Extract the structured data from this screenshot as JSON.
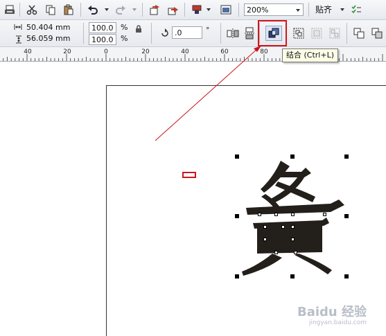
{
  "toolbar_top": {
    "zoom": {
      "value": "200%"
    },
    "snap": {
      "label": "贴齐"
    }
  },
  "toolbar_props": {
    "width": "50.404 mm",
    "height": "56.059 mm",
    "scale_x": "100.0",
    "scale_y": "100.0",
    "percent": "%",
    "rotation": ".0",
    "degree": "°"
  },
  "ruler": {
    "labels": [
      "40",
      "20",
      "0",
      "20",
      "40",
      "60",
      "80",
      "100"
    ]
  },
  "tooltip": {
    "text": "结合 (Ctrl+L)"
  },
  "canvas": {
    "glyph": "鲁",
    "colors": {
      "glyph": "#231f1a",
      "highlight": "#d0161a",
      "arrow": "#c8141b"
    }
  },
  "watermark": {
    "brand": "Baidu 经验",
    "url": "jingyan.baidu.com"
  },
  "icons": [
    "print-icon",
    "cut-icon",
    "copy-icon",
    "paste-icon",
    "undo-icon",
    "redo-icon",
    "import-icon",
    "export-icon",
    "launcher-icon",
    "fullscreen-icon",
    "options-icon",
    "lock-ratio-icon",
    "rotate-icon",
    "mirror-h-icon",
    "mirror-v-icon",
    "combine-icon",
    "group-icon",
    "ungroup-icon",
    "ungroup-all-icon",
    "weld-icon",
    "trim-icon"
  ]
}
